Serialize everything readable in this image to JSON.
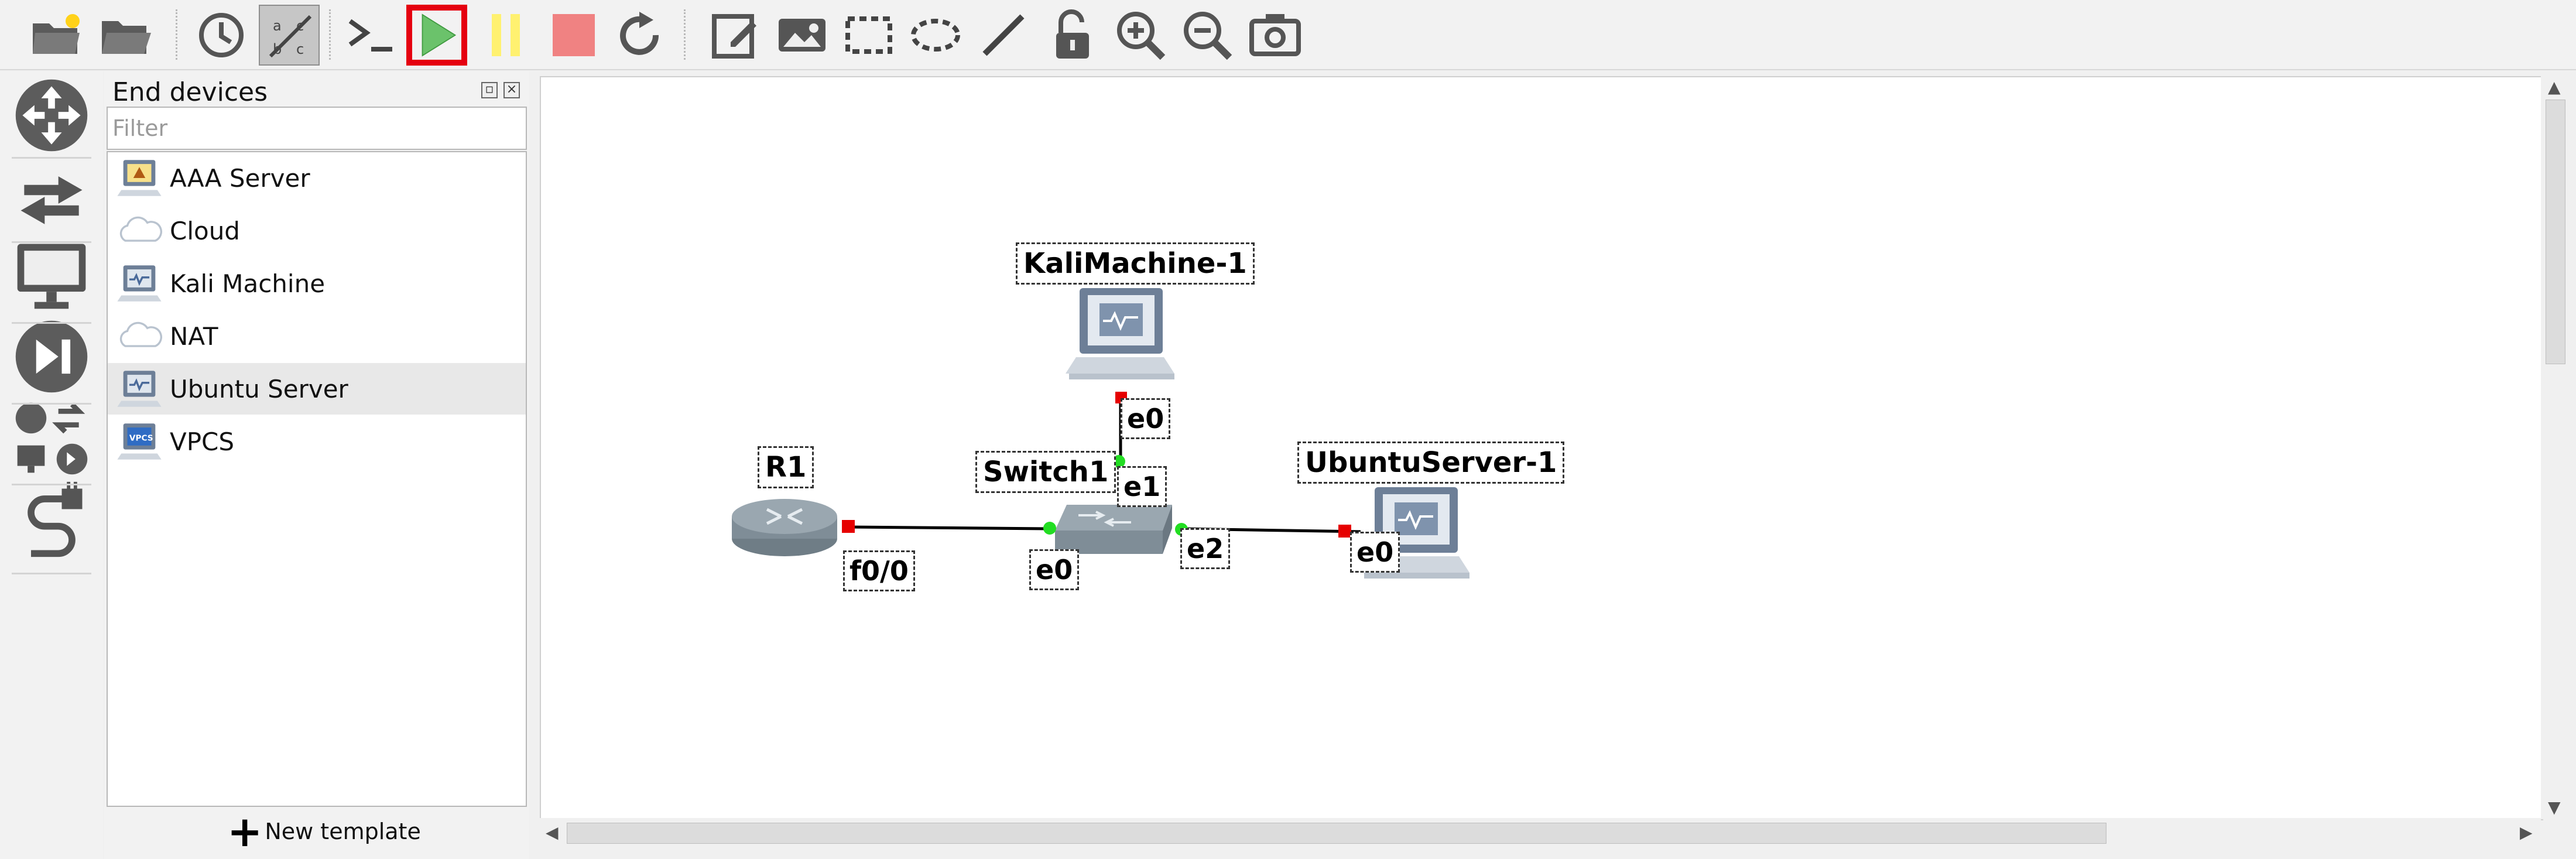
{
  "toolbar": {
    "items": [
      "new-project",
      "open-project",
      "snapshot",
      "show-interface-labels",
      "console-all",
      "start-all",
      "suspend-all",
      "stop-all",
      "reload-all",
      "add-note",
      "insert-picture",
      "draw-rectangle",
      "draw-ellipse",
      "draw-line",
      "lock-items",
      "zoom-in",
      "zoom-out",
      "screenshot"
    ],
    "highlighted": "start-all",
    "pressed": "show-interface-labels"
  },
  "left_dock": {
    "items": [
      "browse-routers",
      "browse-switches",
      "browse-end-devices",
      "browse-security-devices",
      "browse-all-devices",
      "add-link"
    ]
  },
  "panel": {
    "title": "End devices",
    "filter_placeholder": "Filter",
    "devices": [
      {
        "label": "AAA Server",
        "icon": "server-icon"
      },
      {
        "label": "Cloud",
        "icon": "cloud-icon"
      },
      {
        "label": "Kali Machine",
        "icon": "computer-icon"
      },
      {
        "label": "NAT",
        "icon": "cloud-icon"
      },
      {
        "label": "Ubuntu Server",
        "icon": "computer-icon",
        "selected": true
      },
      {
        "label": "VPCS",
        "icon": "vpcs-icon"
      }
    ],
    "new_template_label": "New template"
  },
  "topology": {
    "nodes": {
      "kali": {
        "label": "KaliMachine-1",
        "type": "computer-icon"
      },
      "switch": {
        "label": "Switch1",
        "type": "switch-icon"
      },
      "router": {
        "label": "R1",
        "type": "router-icon"
      },
      "ubuntu": {
        "label": "UbuntuServer-1",
        "type": "computer-icon"
      }
    },
    "ports": {
      "kali_e0": "e0",
      "switch_e1": "e1",
      "switch_e0": "e0",
      "switch_e2": "e2",
      "router_f00": "f0/0",
      "ubuntu_e0": "e0"
    },
    "status_colors": {
      "stopped": "#e60000",
      "started": "#22dd22"
    }
  }
}
